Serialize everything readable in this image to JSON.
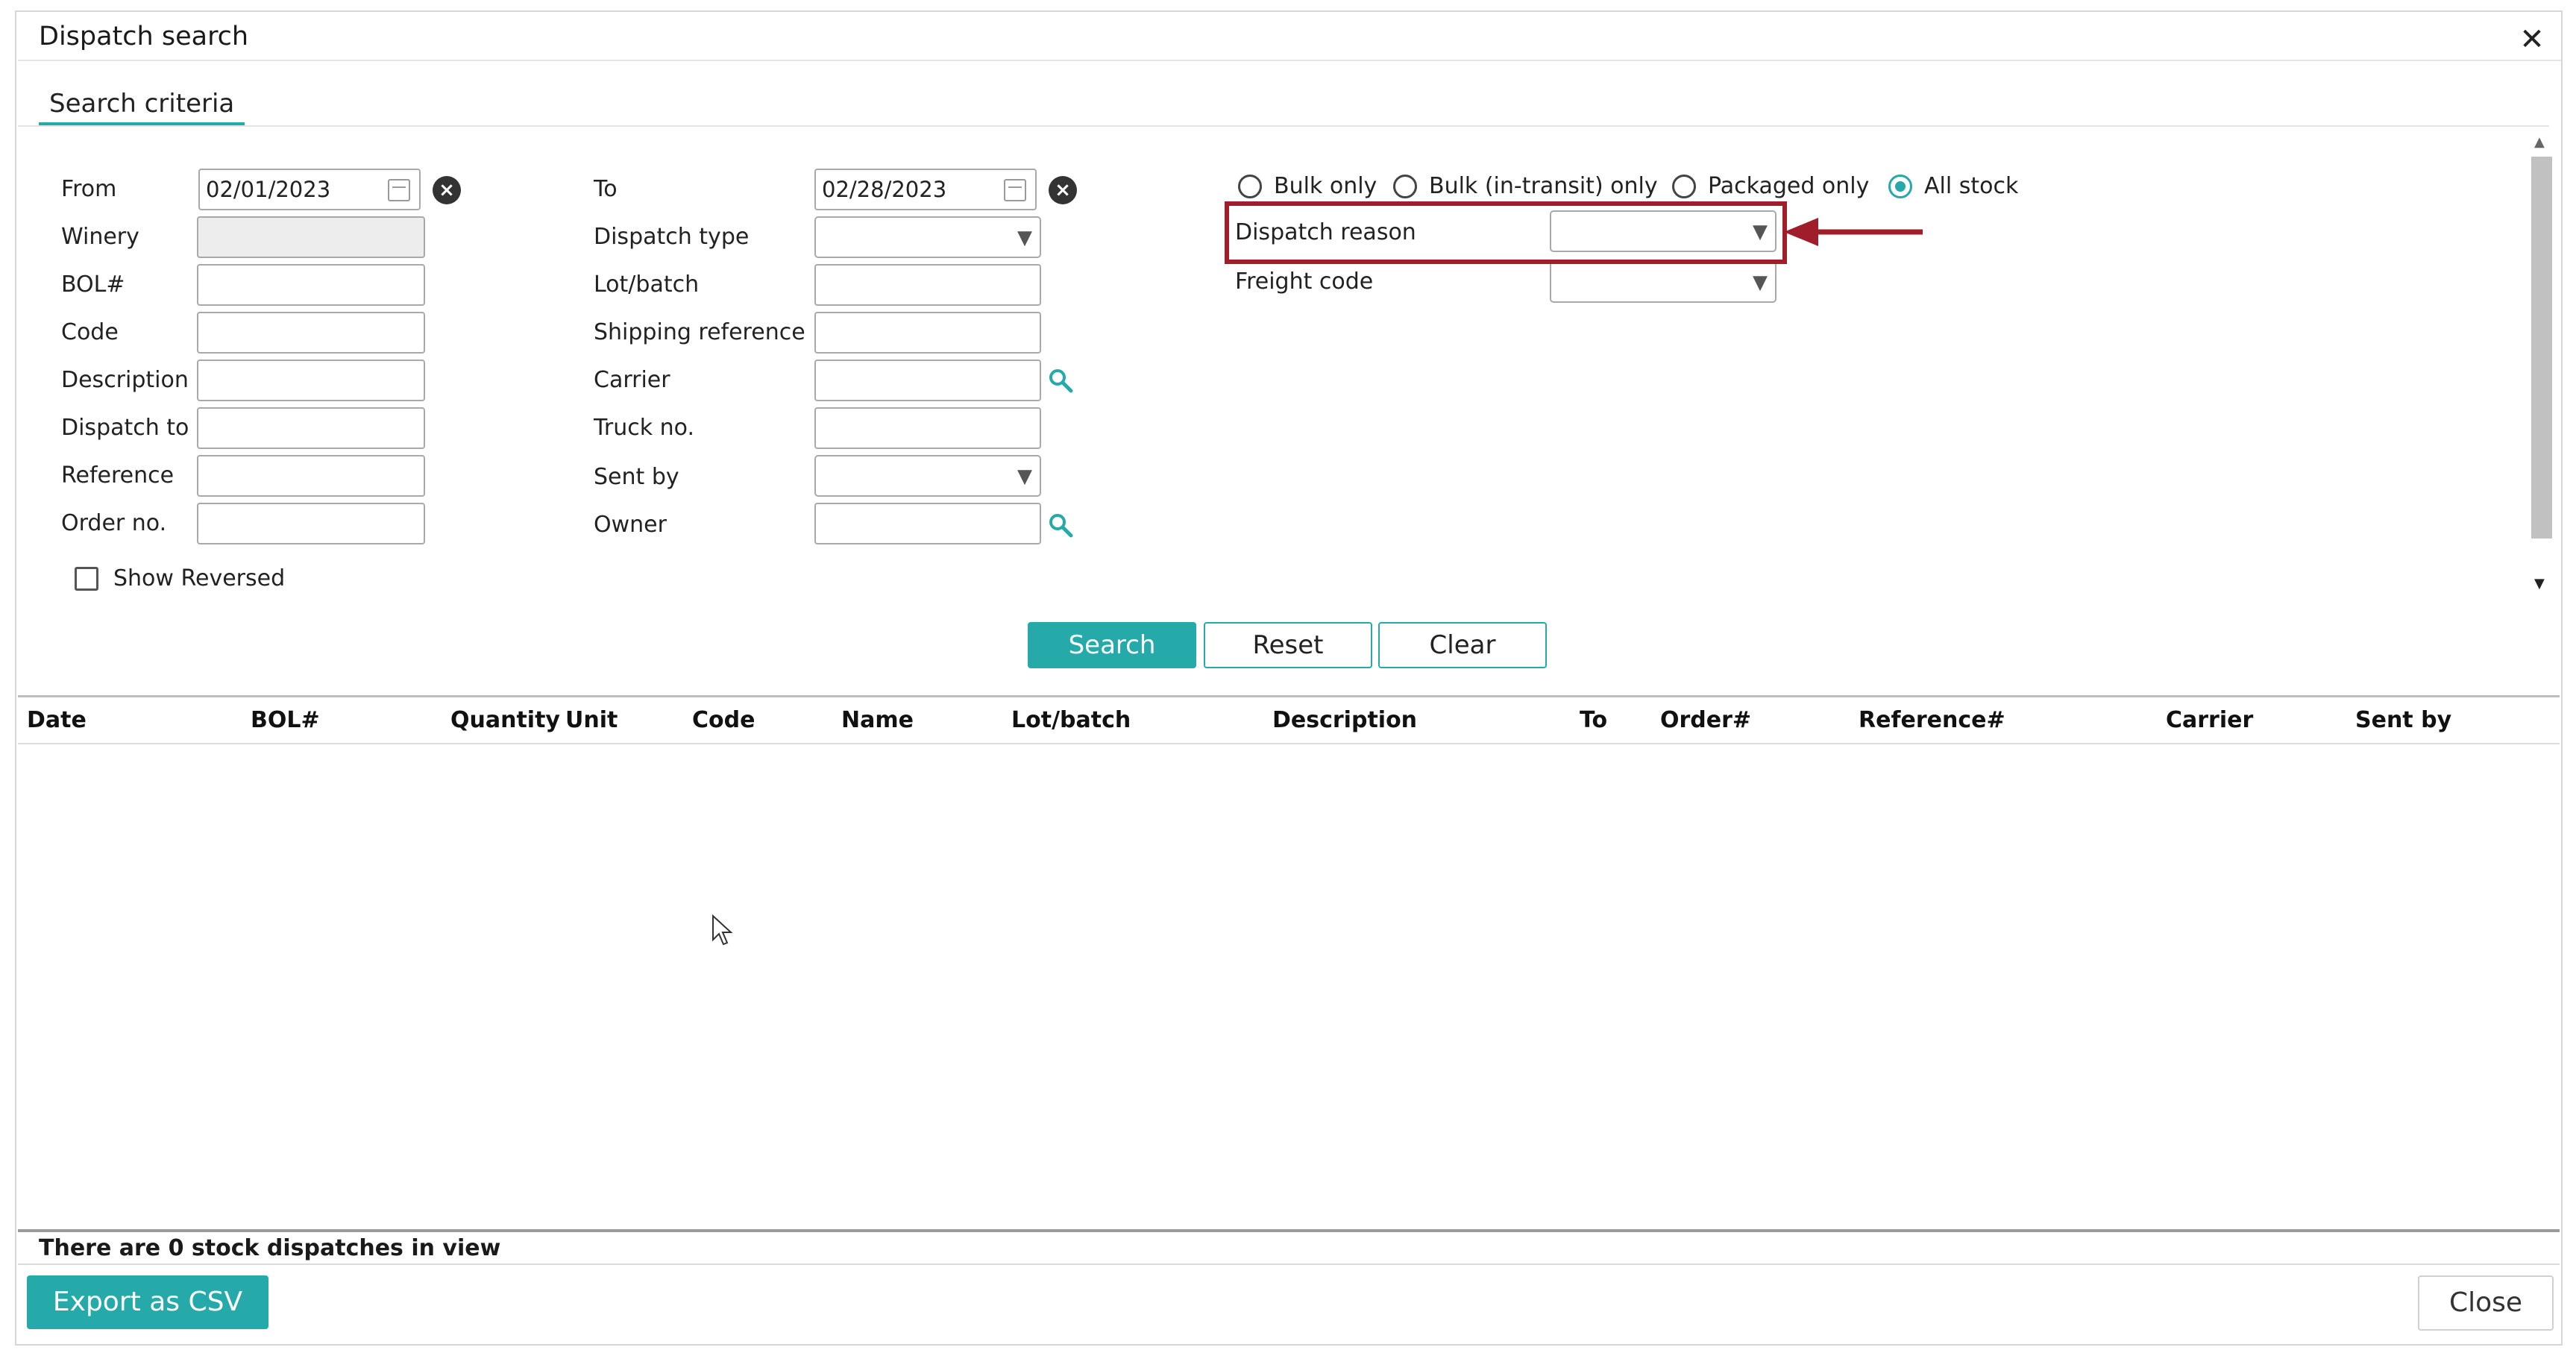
{
  "dialog": {
    "title": "Dispatch search",
    "close_icon": "close-icon"
  },
  "tabs": [
    {
      "label": "Search criteria",
      "active": true
    }
  ],
  "form": {
    "left": {
      "from": {
        "label": "From",
        "value": "02/01/2023"
      },
      "winery": {
        "label": "Winery",
        "value": ""
      },
      "bol": {
        "label": "BOL#",
        "value": ""
      },
      "code": {
        "label": "Code",
        "value": ""
      },
      "description": {
        "label": "Description",
        "value": ""
      },
      "dispatch_to": {
        "label": "Dispatch to",
        "value": ""
      },
      "reference": {
        "label": "Reference",
        "value": ""
      },
      "order_no": {
        "label": "Order no.",
        "value": ""
      },
      "show_reversed": {
        "label": "Show Reversed",
        "checked": false
      }
    },
    "middle": {
      "to": {
        "label": "To",
        "value": "02/28/2023"
      },
      "dispatch_type": {
        "label": "Dispatch type",
        "value": ""
      },
      "lot_batch": {
        "label": "Lot/batch",
        "value": ""
      },
      "shipping_reference": {
        "label": "Shipping reference",
        "value": ""
      },
      "carrier": {
        "label": "Carrier",
        "value": ""
      },
      "truck_no": {
        "label": "Truck no.",
        "value": ""
      },
      "sent_by": {
        "label": "Sent by",
        "value": ""
      },
      "owner": {
        "label": "Owner",
        "value": ""
      }
    },
    "right": {
      "stock_options": [
        {
          "label": "Bulk only",
          "selected": false
        },
        {
          "label": "Bulk (in-transit) only",
          "selected": false
        },
        {
          "label": "Packaged only",
          "selected": false
        },
        {
          "label": "All stock",
          "selected": true
        }
      ],
      "dispatch_reason": {
        "label": "Dispatch reason",
        "value": ""
      },
      "freight_code": {
        "label": "Freight code",
        "value": ""
      }
    }
  },
  "buttons": {
    "search": "Search",
    "reset": "Reset",
    "clear": "Clear",
    "export": "Export as CSV",
    "close": "Close"
  },
  "grid": {
    "columns": [
      "Date",
      "BOL#",
      "Quantity",
      "Unit",
      "Code",
      "Name",
      "Lot/batch",
      "Description",
      "To",
      "Order#",
      "Reference#",
      "Carrier",
      "Sent by"
    ],
    "rows": []
  },
  "status": "There are 0 stock dispatches in view",
  "icons": {
    "calendar": "calendar-icon",
    "clear_date": "clear-circle-icon",
    "dropdown": "chevron-down-icon",
    "lookup": "search-icon",
    "annotation": "arrow-left-icon"
  },
  "colors": {
    "accent": "#26a9a9",
    "annotation": "#a01d2b"
  }
}
